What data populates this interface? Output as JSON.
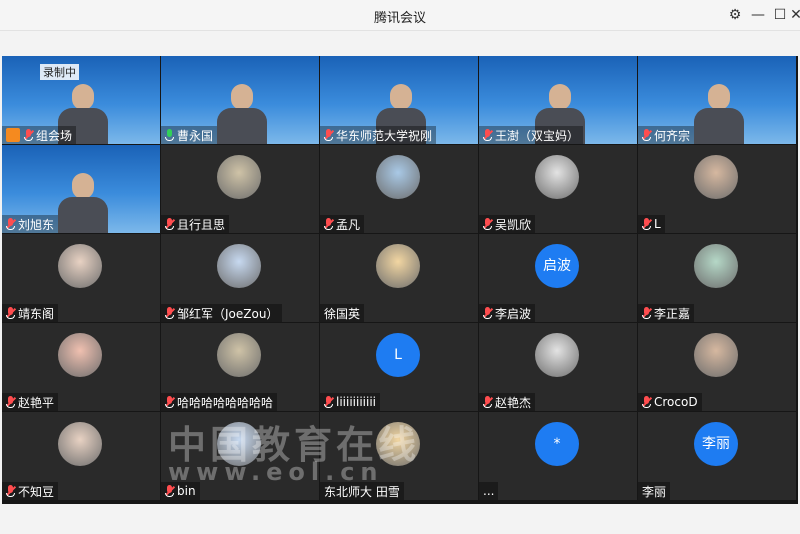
{
  "window": {
    "title": "腾讯会议",
    "controls": [
      "settings-icon",
      "minimize-icon",
      "maximize-icon",
      "close-icon"
    ]
  },
  "recording_badge": "录制中",
  "participants": [
    {
      "name": "组会场",
      "mic": "muted",
      "tile": "video",
      "badge": "orange-user-icon"
    },
    {
      "name": "曹永国",
      "mic": "on",
      "tile": "video"
    },
    {
      "name": "华东师范大学祝刚",
      "mic": "muted",
      "tile": "video"
    },
    {
      "name": "王澍（双宝妈）",
      "mic": "muted",
      "tile": "video"
    },
    {
      "name": "何齐宗",
      "mic": "muted",
      "tile": "video"
    },
    {
      "name": "刘旭东",
      "mic": "muted",
      "tile": "video"
    },
    {
      "name": "且行且思",
      "mic": "muted",
      "tile": "avatar"
    },
    {
      "name": "孟凡",
      "mic": "muted",
      "tile": "avatar"
    },
    {
      "name": "吴凯欣",
      "mic": "muted",
      "tile": "avatar"
    },
    {
      "name": "L",
      "mic": "muted",
      "tile": "avatar"
    },
    {
      "name": "靖东阁",
      "mic": "muted",
      "tile": "avatar"
    },
    {
      "name": "邹红军（JoeZou）",
      "mic": "muted",
      "tile": "avatar"
    },
    {
      "name": "徐国英",
      "mic": "none",
      "tile": "avatar"
    },
    {
      "name": "李启波",
      "mic": "muted",
      "tile": "letter",
      "avatar_text": "启波"
    },
    {
      "name": "李正嘉",
      "mic": "muted",
      "tile": "avatar"
    },
    {
      "name": "赵艳平",
      "mic": "muted",
      "tile": "avatar"
    },
    {
      "name": "哈哈哈哈哈哈哈哈",
      "mic": "muted",
      "tile": "avatar"
    },
    {
      "name": "liiiiiiiiiii",
      "mic": "muted",
      "tile": "letter",
      "avatar_text": "L"
    },
    {
      "name": "赵艳杰",
      "mic": "muted",
      "tile": "avatar"
    },
    {
      "name": "CrocoD",
      "mic": "muted",
      "tile": "avatar"
    },
    {
      "name": "不知豆",
      "mic": "muted",
      "tile": "avatar"
    },
    {
      "name": "bin",
      "mic": "muted",
      "tile": "avatar"
    },
    {
      "name": "东北师大 田雪",
      "mic": "none",
      "tile": "avatar"
    },
    {
      "name": "...",
      "mic": "none",
      "tile": "letter",
      "avatar_text": "*"
    },
    {
      "name": "李丽",
      "mic": "none",
      "tile": "letter",
      "avatar_text": "李丽"
    }
  ],
  "watermark": {
    "text": "中国教育在线",
    "url": "www.eol.cn"
  },
  "colors": {
    "accent": "#1e7cf2",
    "muted": "#ff4d4f",
    "active": "#31d158"
  }
}
